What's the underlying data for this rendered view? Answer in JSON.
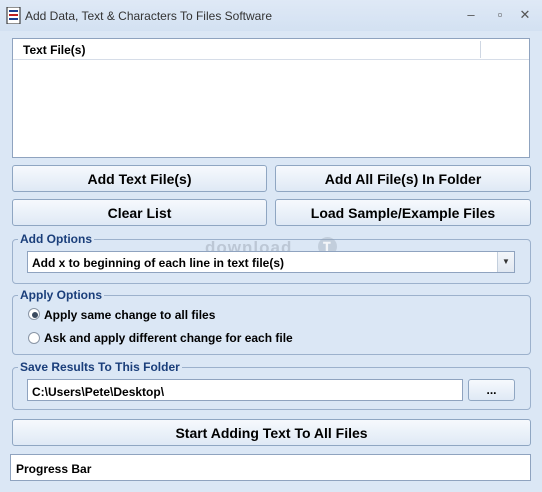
{
  "window": {
    "title": "Add Data, Text & Characters To Files Software",
    "minimize": "–",
    "maximize": "▫",
    "close": "✕"
  },
  "file_list": {
    "columns": [
      "Text File(s)"
    ]
  },
  "buttons": {
    "add_text_files": "Add Text File(s)",
    "add_all_in_folder": "Add All File(s) In Folder",
    "clear_list": "Clear List",
    "load_sample": "Load Sample/Example Files",
    "browse": "...",
    "start": "Start Adding Text To All Files"
  },
  "add_options": {
    "label": "Add Options",
    "selected": "Add x to beginning of each line in text file(s)"
  },
  "apply_options": {
    "label": "Apply Options",
    "options": [
      {
        "label": "Apply same change to all files",
        "checked": true
      },
      {
        "label": "Ask and apply different change for each file",
        "checked": false
      }
    ]
  },
  "save_results": {
    "label": "Save Results To This Folder",
    "path": "C:\\Users\\Pete\\Desktop\\"
  },
  "progress": {
    "label": "Progress Bar"
  },
  "watermark": "download"
}
